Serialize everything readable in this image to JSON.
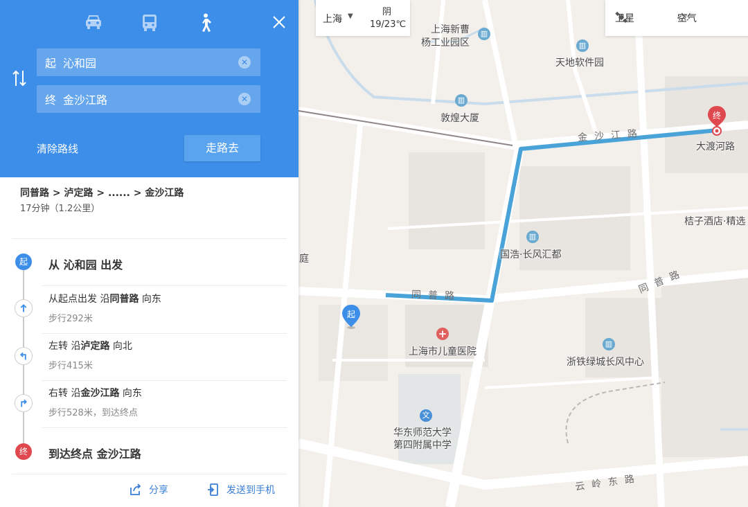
{
  "travel_modes": [
    {
      "name": "car-icon",
      "active": false
    },
    {
      "name": "bus-icon",
      "active": false
    },
    {
      "name": "walk-icon",
      "active": true
    }
  ],
  "route_form": {
    "start_tag": "起",
    "start_value": "沁和园",
    "end_tag": "终",
    "end_value": "金沙江路",
    "clear_label": "清除路线",
    "go_label": "走路去"
  },
  "summary": {
    "route": "同普路 > 泸定路 > ...... > 金沙江路",
    "time_distance": "17分钟（1.2公里）"
  },
  "steps": {
    "start": {
      "badge": "起",
      "text": "从 沁和园 出发"
    },
    "step1": {
      "pre": "从起点出发 沿",
      "road": "同普路",
      "post": " 向东",
      "detail": "步行292米"
    },
    "step2": {
      "pre": "左转 沿",
      "road": "泸定路",
      "post": " 向北",
      "detail": "步行415米"
    },
    "step3": {
      "pre": "右转 沿",
      "road": "金沙江路",
      "post": " 向东",
      "detail": "步行528米，到达终点"
    },
    "end": {
      "badge": "终",
      "text": "到达终点 金沙江路"
    }
  },
  "footer": {
    "share_label": "分享",
    "send_label": "发送到手机"
  },
  "map_controls": {
    "city": "上海",
    "weather_condition": "阴",
    "weather_temp": "19/23℃",
    "satellite_label": "卫星",
    "air_label": "空气"
  },
  "map_labels": {
    "poi1_line1": "上海新曹",
    "poi1_line2": "杨工业园区",
    "poi2": "天地软件园",
    "poi3": "敦煌大厦",
    "poi4": "国浩·长风汇都",
    "poi5": "上海市儿童医院",
    "poi6": "浙铁绿城长风中心",
    "poi7_line1": "华东师范大学",
    "poi7_line2": "第四附属中学",
    "poi8": "大渡河路",
    "poi9": "桔子酒店·精选",
    "poi10": "庭",
    "road1": "金沙江路",
    "road2": "同普路",
    "road3": "同普路",
    "road4": "云岭东路",
    "start_marker": "起",
    "end_marker": "终"
  },
  "colors": {
    "header_blue": "#3c8ee8",
    "route_line": "#4aa3d8",
    "start_blue": "#3c8ee8",
    "end_red": "#e0484f"
  }
}
